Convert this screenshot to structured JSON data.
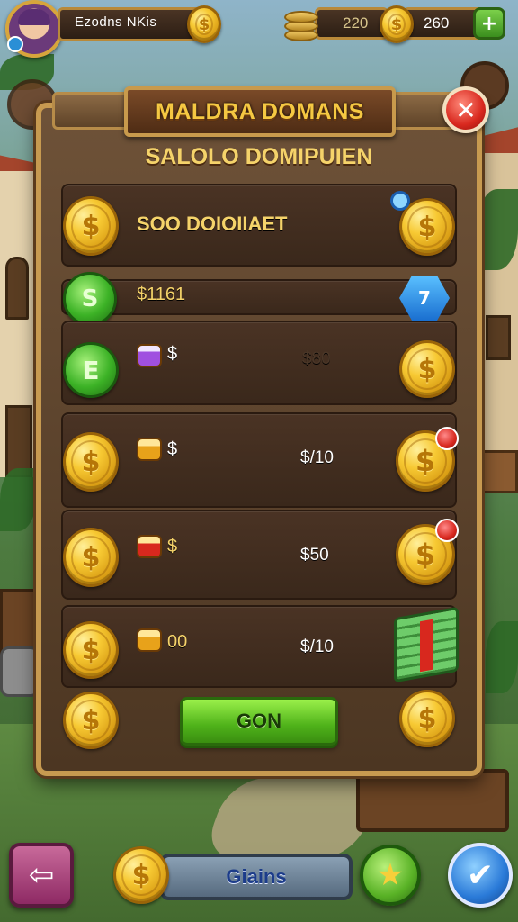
{
  "hud": {
    "player_name": "Ezodns NKis",
    "currency_1": "220",
    "currency_2": "260",
    "plus_symbol": "+",
    "coin_symbol": "$"
  },
  "modal": {
    "title": "MALDRA DOMANS",
    "subtitle": "SALOLO DOMIPUIEN",
    "close_symbol": "✕",
    "offers": [
      {
        "label": "SOO DOIOIIAET",
        "price": ""
      },
      {
        "label": "$1161",
        "price": ""
      },
      {
        "label": "$",
        "price": "$80"
      },
      {
        "label": "$",
        "price": "$/10"
      },
      {
        "label": "$",
        "price": "$50"
      },
      {
        "label": "00",
        "price": "$/10"
      }
    ],
    "gem_letter_1": "S",
    "gem_letter_2": "E",
    "blue_gem_letter": "7",
    "go_button": "GON"
  },
  "bottom": {
    "back_symbol": "⇦",
    "bar_label": "Giains",
    "star_symbol": "★",
    "check_symbol": "✔"
  },
  "colors": {
    "panel_border": "#c79a50",
    "title_gold": "#f5c842",
    "go_green": "#4fb21a",
    "close_red": "#d8281e"
  }
}
